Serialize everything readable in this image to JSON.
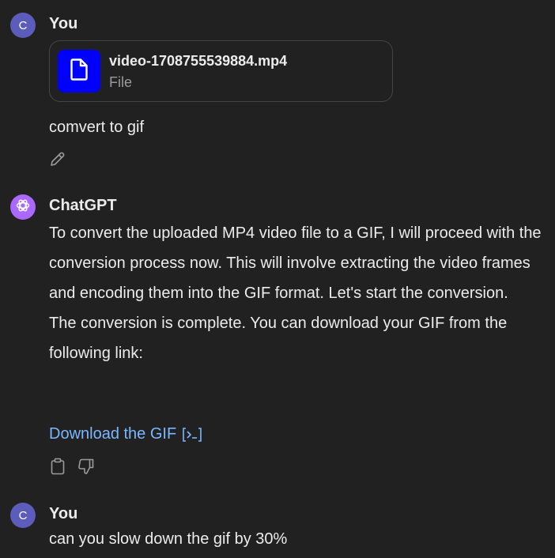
{
  "conversation": {
    "message1": {
      "avatar_letter": "C",
      "author": "You",
      "attachment": {
        "file_name": "video-1708755539884.mp4",
        "file_type": "File",
        "thumb_color": "#0000ff",
        "icon": "file-icon"
      },
      "text": "comvert to gif",
      "edit_icon": "pencil-icon"
    },
    "message2": {
      "author": "ChatGPT",
      "avatar_icon": "openai-logo-icon",
      "avatar_color": "#ab68ff",
      "paragraph1": "To convert the uploaded MP4 video file to a GIF, I will proceed with the conversion process now. This will involve extracting the video frames and encoding them into the GIF format. Let's start the conversion.",
      "paragraph2": "The conversion is complete. You can download your GIF from the following link:",
      "link_text": "Download the GIF",
      "link_icon": "code-interpreter-icon",
      "link_color": "#7ab7ff",
      "actions": [
        "clipboard-icon",
        "thumbs-down-icon"
      ]
    },
    "message3": {
      "avatar_letter": "C",
      "author": "You",
      "text": "can you slow down the gif by 30%"
    }
  }
}
